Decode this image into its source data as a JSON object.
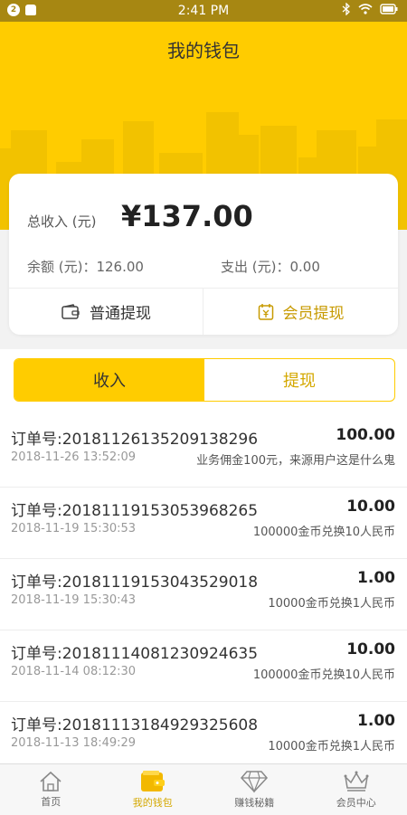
{
  "status_bar": {
    "time": "2:41 PM",
    "notif_count": "2"
  },
  "header": {
    "title": "我的钱包"
  },
  "summary": {
    "total_label": "总收入 (元)",
    "total_amount": "¥137.00",
    "balance": "余额 (元)：126.00",
    "expense": "支出 (元)：0.00",
    "normal_withdraw": "普通提现",
    "vip_withdraw": "会员提现"
  },
  "tabs": [
    {
      "label": "收入",
      "active": true
    },
    {
      "label": "提现",
      "active": false
    }
  ],
  "orders": [
    {
      "no": "订单号:2018112613520913829​6",
      "amount": "100.00",
      "date": "2018-11-26 13:52:09",
      "desc": "业务佣金100元，来源用户这是什么鬼"
    },
    {
      "no": "订单号:20181119153053968265",
      "amount": "10.00",
      "date": "2018-11-19 15:30:53",
      "desc": "100000金币兑换10人民币"
    },
    {
      "no": "订单号:20181119153043529018",
      "amount": "1.00",
      "date": "2018-11-19 15:30:43",
      "desc": "10000金币兑换1人民币"
    },
    {
      "no": "订单号:20181114081230924635",
      "amount": "10.00",
      "date": "2018-11-14 08:12:30",
      "desc": "100000金币兑换10人民币"
    },
    {
      "no": "订单号:20181113184929325608",
      "amount": "1.00",
      "date": "2018-11-13 18:49:29",
      "desc": "10000金币兑换1人民币"
    }
  ],
  "bottom_nav": [
    {
      "label": "首页",
      "icon": "home-icon",
      "active": false
    },
    {
      "label": "我的钱包",
      "icon": "wallet-icon",
      "active": true
    },
    {
      "label": "赚钱秘籍",
      "icon": "diamond-icon",
      "active": false
    },
    {
      "label": "会员中心",
      "icon": "crown-icon",
      "active": false
    }
  ],
  "colors": {
    "brand_yellow": "#ffcc00",
    "status_bar": "#a78712",
    "accent_text": "#d4a800"
  }
}
